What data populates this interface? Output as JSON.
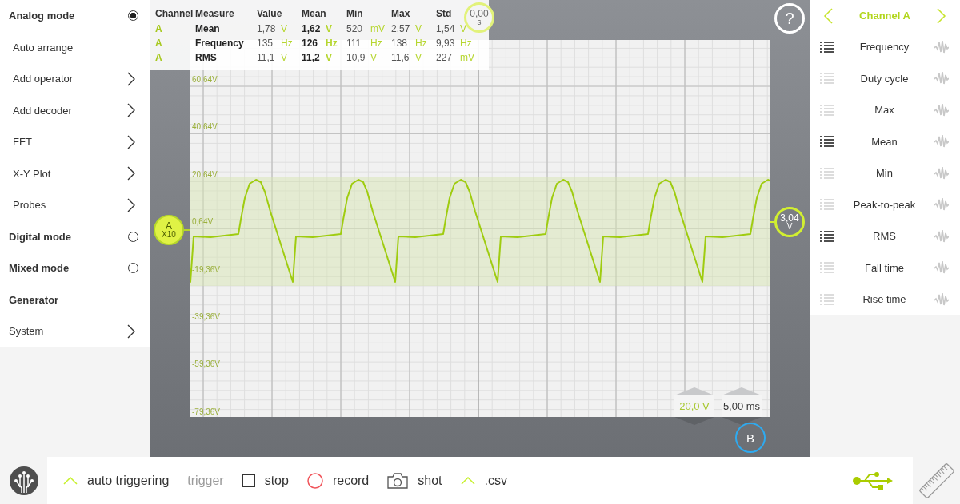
{
  "sidebar": {
    "items": [
      {
        "label": "Analog mode",
        "kind": "mode",
        "bold": true,
        "indented": false,
        "selected": true
      },
      {
        "label": "Auto arrange",
        "kind": "action",
        "bold": false,
        "indented": true
      },
      {
        "label": "Add operator",
        "kind": "submenu",
        "bold": false,
        "indented": true
      },
      {
        "label": "Add decoder",
        "kind": "submenu",
        "bold": false,
        "indented": true
      },
      {
        "label": "FFT",
        "kind": "submenu",
        "bold": false,
        "indented": true
      },
      {
        "label": "X-Y Plot",
        "kind": "submenu",
        "bold": false,
        "indented": true
      },
      {
        "label": "Probes",
        "kind": "submenu",
        "bold": false,
        "indented": true
      },
      {
        "label": "Digital mode",
        "kind": "mode",
        "bold": true,
        "indented": false,
        "selected": false
      },
      {
        "label": "Mixed mode",
        "kind": "mode",
        "bold": true,
        "indented": false,
        "selected": false
      },
      {
        "label": "Generator",
        "kind": "section",
        "bold": true,
        "indented": false
      },
      {
        "label": "System",
        "kind": "submenu",
        "bold": false,
        "indented": false
      }
    ]
  },
  "measurements": {
    "columns": [
      "Channel",
      "Measure",
      "Value",
      "Mean",
      "Min",
      "Max",
      "Std"
    ],
    "rows": [
      {
        "cells": [
          {
            "value": "A"
          },
          {
            "value": "Mean"
          },
          {
            "value": "1,78",
            "unit": "V"
          },
          {
            "value": "1,62",
            "unit": "V"
          },
          {
            "value": "520",
            "unit": "mV"
          },
          {
            "value": "2,57",
            "unit": "V"
          },
          {
            "value": "1,54",
            "unit": "V"
          }
        ]
      },
      {
        "cells": [
          {
            "value": "A"
          },
          {
            "value": "Frequency"
          },
          {
            "value": "135",
            "unit": "Hz"
          },
          {
            "value": "126",
            "unit": "Hz"
          },
          {
            "value": "111",
            "unit": "Hz"
          },
          {
            "value": "138",
            "unit": "Hz"
          },
          {
            "value": "9,93",
            "unit": "Hz"
          }
        ]
      },
      {
        "cells": [
          {
            "value": "A"
          },
          {
            "value": "RMS"
          },
          {
            "value": "11,1",
            "unit": "V"
          },
          {
            "value": "11,2",
            "unit": "V"
          },
          {
            "value": "10,9",
            "unit": "V"
          },
          {
            "value": "11,6",
            "unit": "V"
          },
          {
            "value": "227",
            "unit": "mV"
          }
        ]
      }
    ]
  },
  "plot": {
    "y_labels": [
      "60,64V",
      "40,64V",
      "20,64V",
      "0,64V",
      "-19,36V",
      "-39,36V",
      "-59,36V",
      "-79,36V"
    ],
    "trigger_time": {
      "value": "0,00",
      "unit": "s"
    },
    "help": "?",
    "channel_marker": {
      "label": "A",
      "probe": "X10"
    },
    "offset_marker": {
      "value": "3,04",
      "unit": "V"
    },
    "volts_per_div": "20,0 V",
    "time_per_div": "5,00 ms",
    "channel_b": "B"
  },
  "right_panel": {
    "title": "Channel A",
    "items": [
      {
        "label": "Frequency",
        "active": true
      },
      {
        "label": "Duty cycle",
        "active": false
      },
      {
        "label": "Max",
        "active": false
      },
      {
        "label": "Mean",
        "active": true
      },
      {
        "label": "Min",
        "active": false
      },
      {
        "label": "Peak-to-peak",
        "active": false
      },
      {
        "label": "RMS",
        "active": true
      },
      {
        "label": "Fall time",
        "active": false
      },
      {
        "label": "Rise time",
        "active": false
      }
    ]
  },
  "bottom_bar": {
    "items": [
      {
        "kind": "chevron",
        "label": "auto triggering",
        "disabled": false
      },
      {
        "kind": "plain",
        "label": "trigger",
        "disabled": true
      },
      {
        "kind": "checkbox",
        "label": "stop",
        "disabled": false,
        "checked": false
      },
      {
        "kind": "record",
        "label": "record",
        "disabled": false
      },
      {
        "kind": "camera",
        "label": "shot",
        "disabled": false
      },
      {
        "kind": "chevron",
        "label": ".csv",
        "disabled": false
      }
    ]
  }
}
